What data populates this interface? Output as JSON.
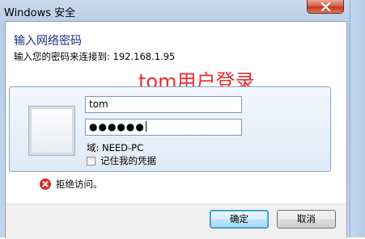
{
  "window": {
    "title": "Windows 安全"
  },
  "dialog": {
    "heading": "输入网络密码",
    "subtext": "输入您的密码来连接到: 192.168.1.95",
    "watermark": "tom用户登录",
    "username_value": "tom",
    "password_masked": "●●●●●●",
    "domain_text": "域: NEED-PC",
    "remember_label": "记住我的凭据",
    "remember_checked": false,
    "error_text": "拒绝访问。"
  },
  "buttons": {
    "ok_label": "确定",
    "cancel_label": "取消"
  },
  "icons": {
    "close": "close-icon",
    "error": "error-icon",
    "user_tile": "user-tile"
  },
  "colors": {
    "heading": "#1e3287",
    "watermark": "#ee2b2b",
    "close_button": "#c4381b",
    "error_icon": "#d8352a"
  }
}
